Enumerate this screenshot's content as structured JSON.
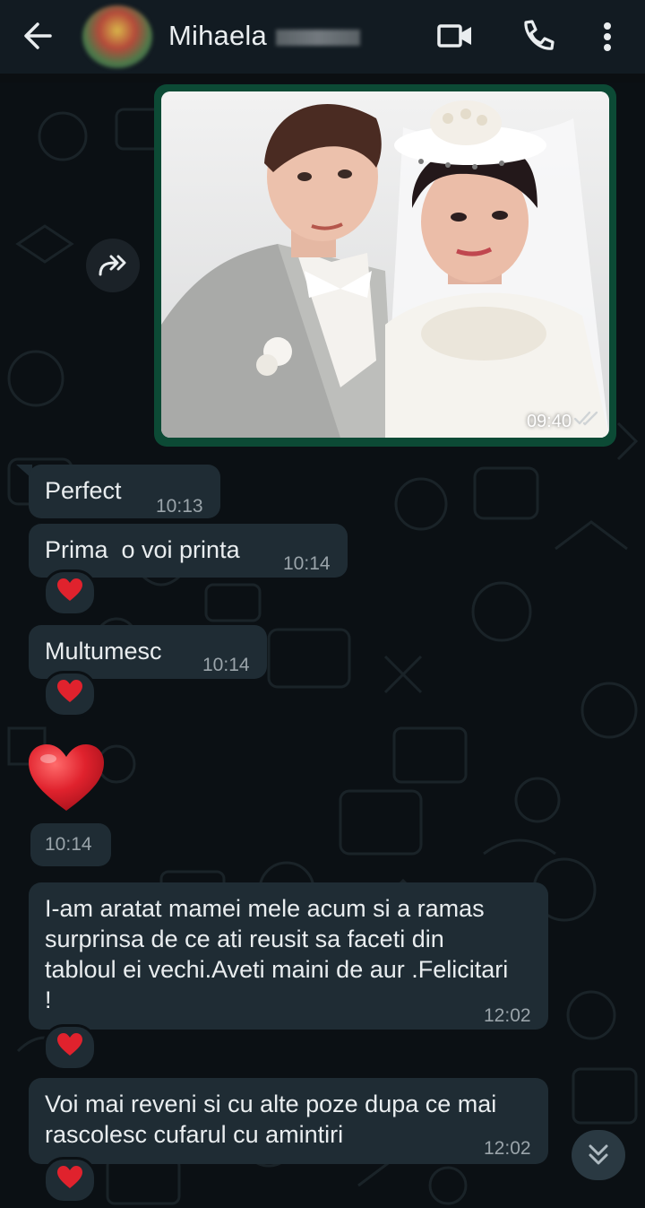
{
  "header": {
    "contact_name": "Mihaela",
    "icons": {
      "back": "arrow-left-icon",
      "video": "video-camera-icon",
      "call": "phone-icon",
      "menu": "more-vertical-icon"
    }
  },
  "messages": [
    {
      "type": "image",
      "time": "09:40",
      "status": "delivered"
    },
    {
      "type": "text",
      "text": "Perfect",
      "time": "10:13"
    },
    {
      "type": "text",
      "text": "Prima  o voi printa",
      "time": "10:14",
      "reaction": "❤️"
    },
    {
      "type": "text",
      "text": "Multumesc",
      "time": "10:14",
      "reaction": "❤️"
    },
    {
      "type": "emoji",
      "emoji": "❤️",
      "time": "10:14"
    },
    {
      "type": "text",
      "text": "I-am aratat mamei mele acum si a ramas surprinsa de ce ati reusit sa faceti din tabloul ei vechi.Aveti maini de aur .Felicitari !",
      "time": "12:02",
      "reaction": "❤️"
    },
    {
      "type": "text",
      "text": "Voi mai reveni si cu alte poze dupa ce mai rascolesc cufarul cu amintiri",
      "time": "12:02",
      "reaction": "❤️"
    }
  ],
  "colors": {
    "header_bg": "#121b22",
    "incoming_bubble": "#1f2c34",
    "image_border": "#0c4a35",
    "timestamp": "#9aa4aa",
    "heart": "#e0222d"
  }
}
